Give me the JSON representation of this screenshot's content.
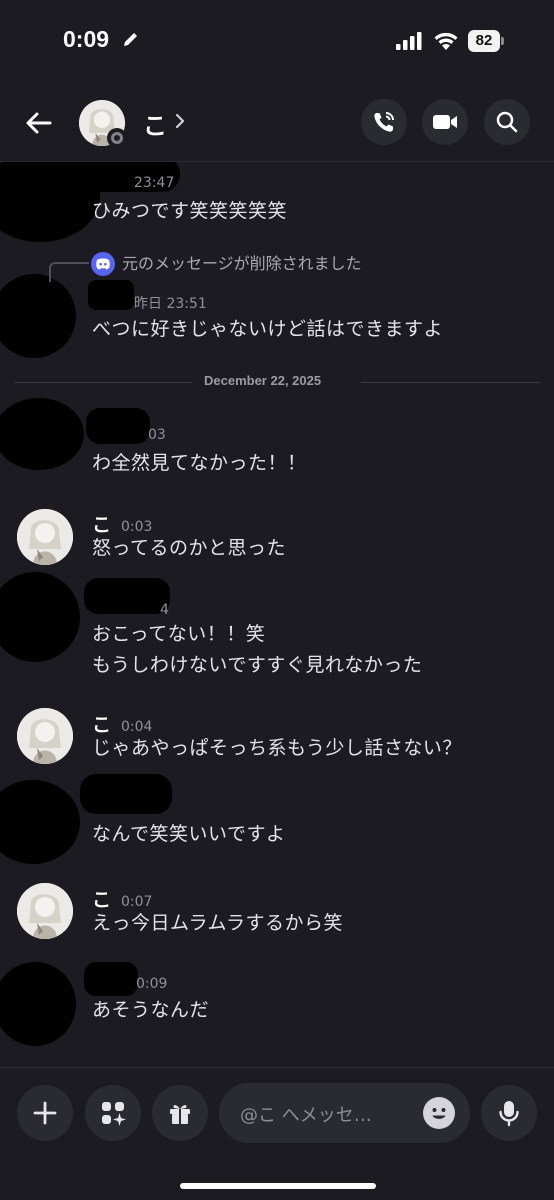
{
  "status_bar": {
    "time": "0:09",
    "battery": "82",
    "icons": [
      "pencil-icon",
      "signal-icon",
      "wifi-icon",
      "battery-icon"
    ]
  },
  "header": {
    "name": "こ",
    "icons": [
      "back-arrow-icon",
      "phone-call-icon",
      "video-camera-icon",
      "search-icon"
    ]
  },
  "messages": {
    "m1": {
      "time": "23:47",
      "text": "ひみつです笑笑笑笑笑"
    },
    "reply": {
      "text": "元のメッセージが削除されました"
    },
    "m2": {
      "time": "昨日 23:51",
      "text": "べつに好きじゃないけど話はできますよ"
    },
    "divider": "December 22, 2025",
    "m3": {
      "time": "03",
      "text": "わ全然見てなかった！！"
    },
    "m4": {
      "author": "こ",
      "time": "0:03",
      "text": "怒ってるのかと思った"
    },
    "m5": {
      "time": "4",
      "line1": "おこってない！！笑",
      "line2": "もうしわけないですすぐ見れなかった"
    },
    "m6": {
      "author": "こ",
      "time": "0:04",
      "text": "じゃあやっぱそっち系もう少し話さない？"
    },
    "m7": {
      "text": "なんで笑笑いいですよ"
    },
    "m8": {
      "author": "こ",
      "time": "0:07",
      "text": "えっ今日ムラムラするから笑"
    },
    "m9": {
      "time": "0:09",
      "text": "あそうなんだ"
    }
  },
  "composer": {
    "placeholder": "@こ へメッセ…",
    "icons": [
      "plus-icon",
      "sparkle-apps-icon",
      "gift-icon",
      "emoji-icon",
      "microphone-icon"
    ]
  },
  "colors": {
    "background": "#1b1b21",
    "button": "#2a2a31",
    "discord_blurple": "#5865f2",
    "text": "#e3e3e8",
    "muted": "#8f909a"
  }
}
